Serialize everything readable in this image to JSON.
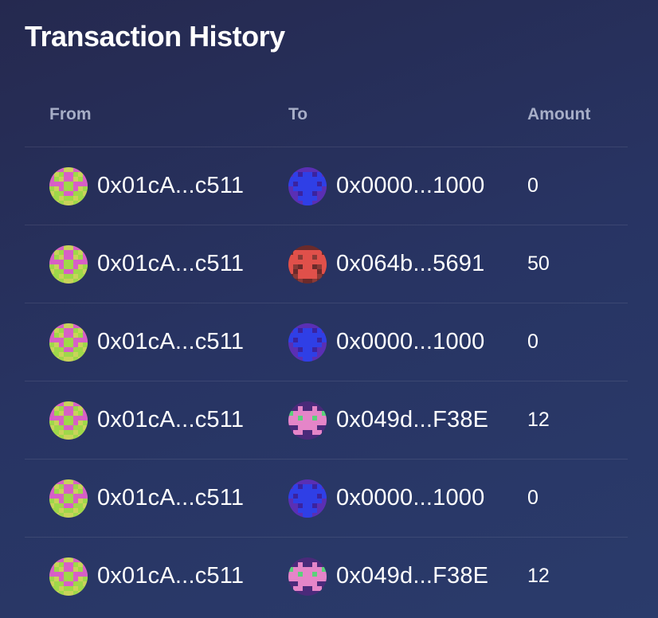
{
  "title": "Transaction History",
  "columns": {
    "from": "From",
    "to": "To",
    "amount": "Amount"
  },
  "rows": [
    {
      "from": "0x01cA...c511",
      "from_avatar": "identicon-green-pink",
      "to": "0x0000...1000",
      "to_avatar": "identicon-blue-purple",
      "amount": "0"
    },
    {
      "from": "0x01cA...c511",
      "from_avatar": "identicon-green-pink",
      "to": "0x064b...5691",
      "to_avatar": "identicon-red-brown",
      "amount": "50"
    },
    {
      "from": "0x01cA...c511",
      "from_avatar": "identicon-green-pink",
      "to": "0x0000...1000",
      "to_avatar": "identicon-blue-purple",
      "amount": "0"
    },
    {
      "from": "0x01cA...c511",
      "from_avatar": "identicon-green-pink",
      "to": "0x049d...F38E",
      "to_avatar": "identicon-pink-purple",
      "amount": "12"
    },
    {
      "from": "0x01cA...c511",
      "from_avatar": "identicon-green-pink",
      "to": "0x0000...1000",
      "to_avatar": "identicon-blue-purple",
      "amount": "0"
    },
    {
      "from": "0x01cA...c511",
      "from_avatar": "identicon-green-pink",
      "to": "0x049d...F38E",
      "to_avatar": "identicon-pink-purple",
      "amount": "12"
    }
  ],
  "colors": {
    "background_start": "#25294f",
    "background_end": "#2a3b6b",
    "header_text": "#a7aec7",
    "text": "#ffffff"
  }
}
